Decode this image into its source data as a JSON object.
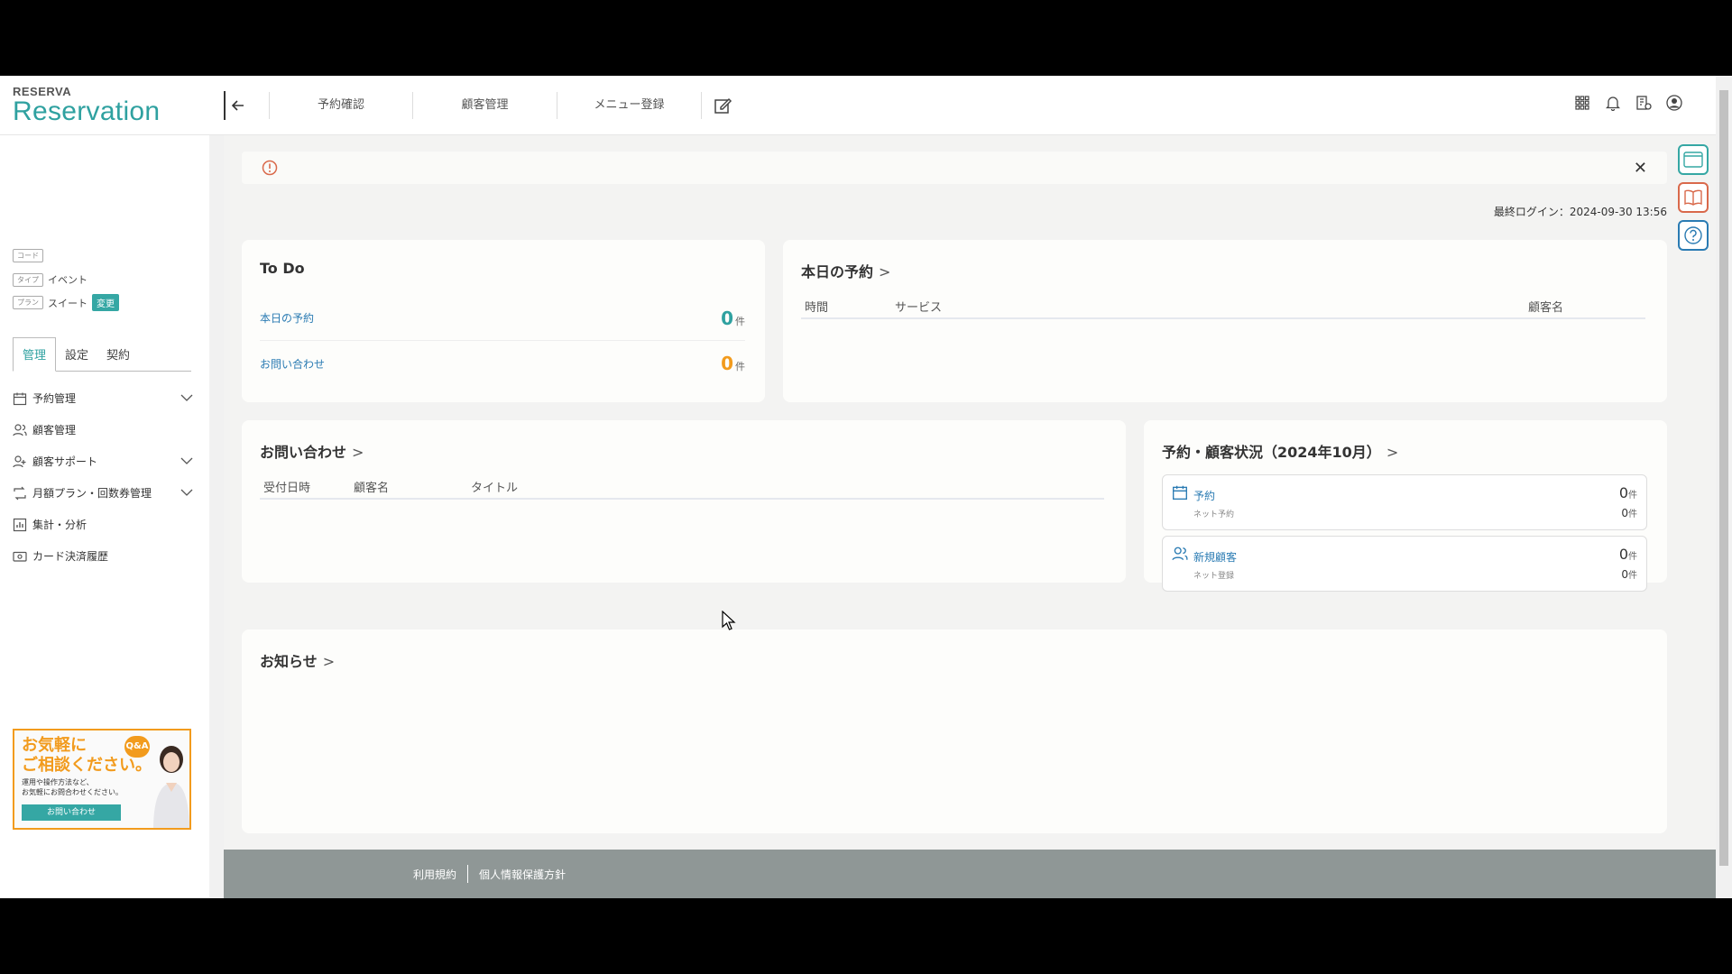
{
  "header": {
    "logo_small": "RESERVA",
    "logo_main": "Reservation",
    "nav": [
      "予約確認",
      "顧客管理",
      "メニュー登録"
    ]
  },
  "sidebar": {
    "meta": [
      {
        "tag": "コード",
        "value": ""
      },
      {
        "tag": "タイプ",
        "value": "イベント"
      },
      {
        "tag": "プラン",
        "value": "スイート",
        "badge": "変更"
      }
    ],
    "tabs": [
      "管理",
      "設定",
      "契約"
    ],
    "items": [
      {
        "label": "予約管理",
        "icon": "calendar-icon",
        "expandable": true
      },
      {
        "label": "顧客管理",
        "icon": "users-icon",
        "expandable": false
      },
      {
        "label": "顧客サポート",
        "icon": "user-support-icon",
        "expandable": true
      },
      {
        "label": "月額プラン・回数券管理",
        "icon": "repeat-icon",
        "expandable": true
      },
      {
        "label": "集計・分析",
        "icon": "chart-icon",
        "expandable": false
      },
      {
        "label": "カード決済履歴",
        "icon": "card-icon",
        "expandable": false
      }
    ],
    "banner": {
      "title_line1": "お気軽に",
      "title_line2": "ご相談ください。",
      "qa": "Q&A",
      "sub_line1": "運用や操作方法など、",
      "sub_line2": "お気軽にお問合わせください。",
      "button": "お問い合わせ"
    }
  },
  "main": {
    "last_login": "最終ログイン：2024-09-30 13:56",
    "todo": {
      "title": "To Do",
      "rows": [
        {
          "label": "本日の予約",
          "count": "0",
          "unit": "件"
        },
        {
          "label": "お問い合わせ",
          "count": "0",
          "unit": "件"
        }
      ]
    },
    "today": {
      "title": "本日の予約",
      "columns": [
        "時間",
        "サービス",
        "顧客名"
      ]
    },
    "inquiry": {
      "title": "お問い合わせ",
      "columns": [
        "受付日時",
        "顧客名",
        "タイトル"
      ]
    },
    "status": {
      "title": "予約・顧客状況（2024年10月）",
      "boxes": [
        {
          "label": "予約",
          "sub": "ネット予約",
          "value": "0",
          "subvalue": "0",
          "unit": "件"
        },
        {
          "label": "新規顧客",
          "sub": "ネット登録",
          "value": "0",
          "subvalue": "0",
          "unit": "件"
        }
      ]
    },
    "news": {
      "title": "お知らせ"
    }
  },
  "footer": {
    "links": [
      "利用規約",
      "個人情報保護方針"
    ]
  },
  "colors": {
    "accent": "#2fa1a0",
    "link": "#2a7bb3",
    "warning": "#f29b1d",
    "alert": "#d9694b"
  }
}
